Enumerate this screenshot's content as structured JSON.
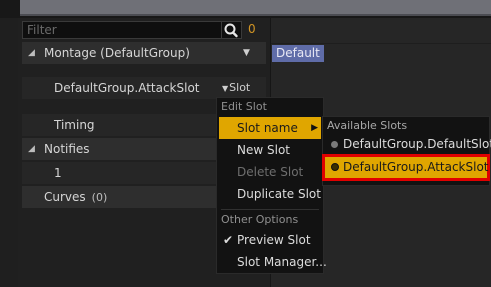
{
  "filter": {
    "placeholder": "Filter",
    "count": "0"
  },
  "details": {
    "montage_header": "Montage (DefaultGroup)",
    "slot_row": {
      "label": "DefaultGroup.AttackSlot",
      "button": "Slot"
    },
    "timing_label": "Timing",
    "notifies_header": "Notifies",
    "notify_value": "1",
    "curves": {
      "label": "Curves",
      "count": "(0)"
    }
  },
  "timeline": {
    "group_label": "Default"
  },
  "context_menu": {
    "heading_edit": "Edit Slot",
    "items_edit": [
      "Slot name",
      "New Slot",
      "Delete Slot",
      "Duplicate Slot"
    ],
    "heading_other": "Other Options",
    "items_other": [
      "Preview Slot",
      "Slot Manager..."
    ]
  },
  "submenu": {
    "heading": "Available Slots",
    "items": [
      "DefaultGroup.DefaultSlot",
      "DefaultGroup.AttackSlot"
    ]
  },
  "colors": {
    "accent": "#e0a600",
    "highlight": "#e00000",
    "group_label": "#5f6ca8"
  },
  "icons": {
    "search": "search-icon",
    "collapse": "triangle-down-icon",
    "submenu": "chevron-right-icon",
    "check": "check-icon",
    "radio": "radio-icon"
  }
}
